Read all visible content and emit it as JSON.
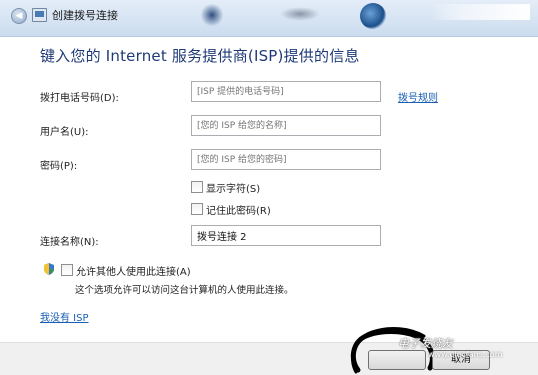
{
  "window": {
    "title": "创建拨号连接",
    "back_icon": "back-arrow-icon",
    "app_icon": "network-connection-icon"
  },
  "heading": "键入您的 Internet 服务提供商(ISP)提供的信息",
  "form": {
    "phone": {
      "label": "拨打电话号码(D):",
      "placeholder": "[ISP 提供的电话号码]",
      "value": ""
    },
    "dialing_rules_link": "拨号规则",
    "username": {
      "label": "用户名(U):",
      "placeholder": "[您的 ISP 给您的名称]",
      "value": ""
    },
    "password": {
      "label": "密码(P):",
      "placeholder": "[您的 ISP 给您的密码]",
      "value": ""
    },
    "show_characters": {
      "label": "显示字符(S)",
      "checked": false
    },
    "remember_password": {
      "label": "记住此密码(R)",
      "checked": false
    },
    "connection_name": {
      "label": "连接名称(N):",
      "value": "拨号连接 2"
    },
    "allow_others": {
      "label": "允许其他人使用此连接(A)",
      "checked": false,
      "icon": "uac-shield-icon"
    },
    "allow_others_note": "这个选项允许可以访问这台计算机的人使用此连接。"
  },
  "no_isp_link": "我没有 ISP",
  "footer": {
    "cancel_label": "取消"
  },
  "watermark": {
    "text": "电子发烧友",
    "url": "www.elecfans.com"
  },
  "colors": {
    "heading": "#1f3a78",
    "link": "#1a5fb4"
  }
}
